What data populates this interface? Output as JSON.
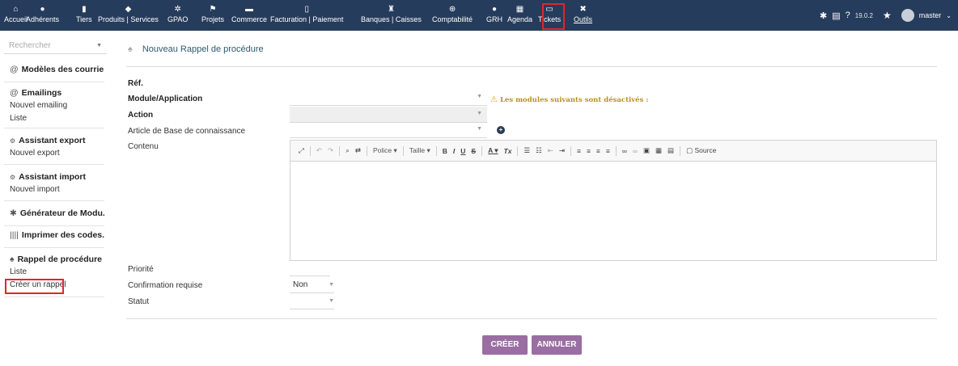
{
  "topbar": {
    "menu": [
      {
        "label": "Accueil",
        "icon": "home-icon",
        "glyph": "⌂"
      },
      {
        "label": "Adhérents",
        "icon": "user-icon",
        "glyph": "●"
      },
      {
        "label": "Tiers",
        "icon": "building-icon",
        "glyph": "▮"
      },
      {
        "label": "Produits | Services",
        "icon": "cube-icon",
        "glyph": "◆"
      },
      {
        "label": "GPAO",
        "icon": "cogs-icon",
        "glyph": "✲"
      },
      {
        "label": "Projets",
        "icon": "project-icon",
        "glyph": "⚑"
      },
      {
        "label": "Commerce",
        "icon": "briefcase-icon",
        "glyph": "▬"
      },
      {
        "label": "Facturation | Paiement",
        "icon": "invoice-icon",
        "glyph": "▯"
      },
      {
        "label": "Banques | Caisses",
        "icon": "bank-icon",
        "glyph": "♜"
      },
      {
        "label": "Comptabilité",
        "icon": "search-dollar-icon",
        "glyph": "⊕"
      },
      {
        "label": "GRH",
        "icon": "hr-icon",
        "glyph": "●"
      },
      {
        "label": "Agenda",
        "icon": "calendar-icon",
        "glyph": "▦"
      },
      {
        "label": "Tickets",
        "icon": "ticket-icon",
        "glyph": "▭"
      },
      {
        "label": "Outils",
        "icon": "tools-icon",
        "glyph": "✖"
      }
    ],
    "version": "19.0.2",
    "user": "master"
  },
  "sidebar": {
    "search_placeholder": "Rechercher",
    "modeles_title": "Modèles des courriels",
    "emailings_title": "Emailings",
    "emailings_new": "Nouvel emailing",
    "emailings_list": "Liste",
    "export_title": "Assistant export",
    "export_new": "Nouvel export",
    "import_title": "Assistant import",
    "import_new": "Nouvel import",
    "generator_title": "Générateur de Modu...",
    "barcode_title": "Imprimer des codes...",
    "reminder_title": "Rappel de procédure",
    "reminder_list": "Liste",
    "reminder_create": "Créer un rappel"
  },
  "main": {
    "title": "Nouveau Rappel de procédure",
    "fields": {
      "ref": "Réf.",
      "module": "Module/Application",
      "action": "Action",
      "kb_article": "Article de Base de connaissance",
      "content": "Contenu",
      "priority": "Priorité",
      "confirmation": "Confirmation requise",
      "status": "Statut"
    },
    "warning": "Les modules suivants sont désactivés :",
    "confirmation_value": "Non",
    "toolbar": {
      "font": "Police",
      "size": "Taille",
      "source": "Source"
    },
    "create_label": "CRÉER",
    "cancel_label": "ANNULER"
  },
  "colors": {
    "topbar": "#263c5c",
    "button": "#9a6ea2",
    "highlight": "#e0262b"
  }
}
